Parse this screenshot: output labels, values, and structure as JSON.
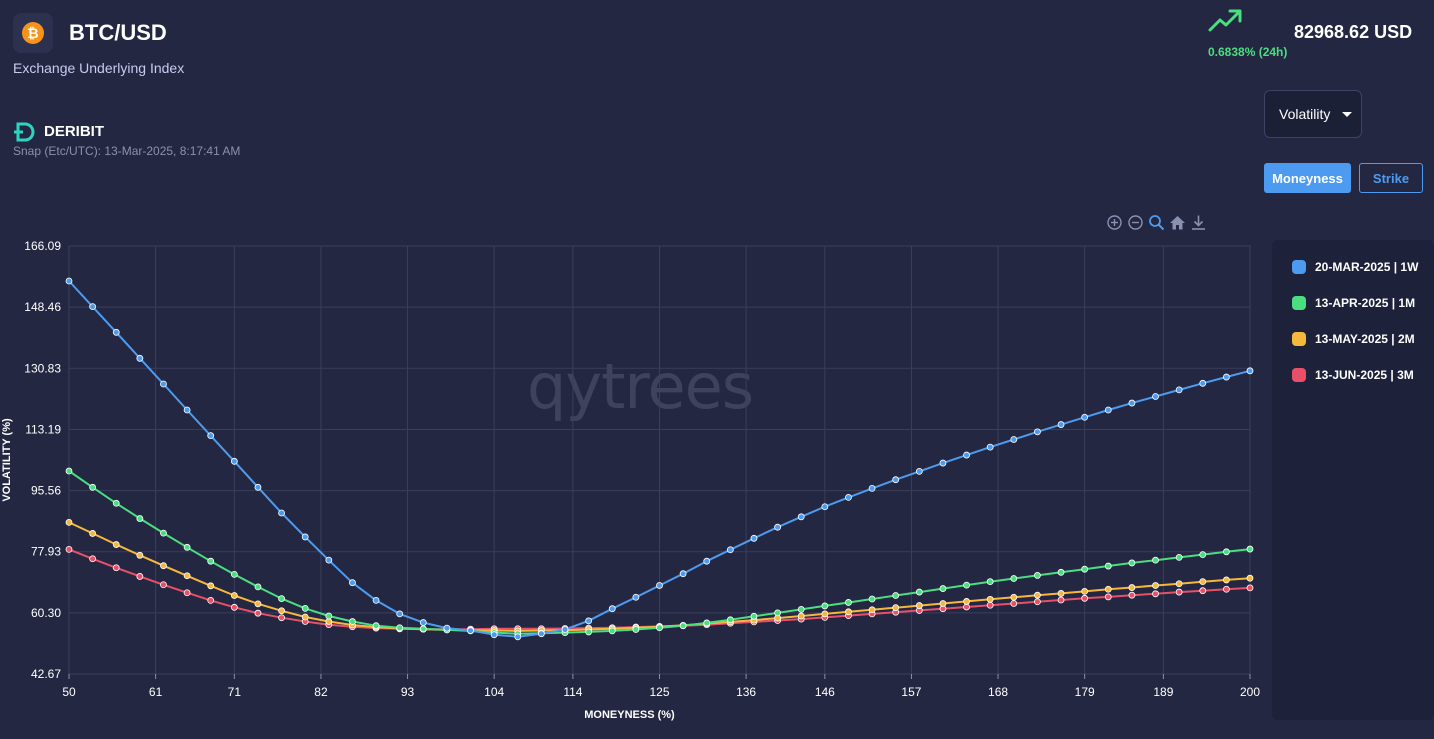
{
  "header": {
    "coin_icon": "bitcoin-icon",
    "coin_glyph": "₿",
    "pair": "BTC/USD",
    "subtitle": "Exchange Underlying Index",
    "change": "0.6838% (24h)",
    "price": "82968.62 USD",
    "trend_icon": "trend-up-icon",
    "change_color": "#4ade80"
  },
  "exchange": {
    "icon": "deribit-logo-icon",
    "name": "DERIBIT",
    "snap": "Snap (Etc/UTC): 13-Mar-2025, 8:17:41 AM"
  },
  "controls": {
    "select_value": "Volatility",
    "mode_buttons": [
      "Moneyness",
      "Strike"
    ],
    "active_mode": "Moneyness",
    "toolbar_icons": [
      "zoom-in-icon",
      "zoom-out-icon",
      "zoom-select-icon",
      "home-reset-icon",
      "download-icon"
    ]
  },
  "watermark": "qytrees",
  "chart_data": {
    "type": "line",
    "xlabel": "MONEYNESS (%)",
    "ylabel": "VOLATILITY (%)",
    "xlim": [
      50,
      200
    ],
    "ylim": [
      42.67,
      166.09
    ],
    "xticks": [
      "50",
      "61",
      "71",
      "82",
      "93",
      "104",
      "114",
      "125",
      "136",
      "146",
      "157",
      "168",
      "179",
      "189",
      "200"
    ],
    "yticks": [
      "42.67",
      "60.30",
      "77.93",
      "95.56",
      "113.19",
      "130.83",
      "148.46",
      "166.09"
    ],
    "grid": true,
    "legend_position": "right",
    "x": [
      50,
      53,
      56,
      59,
      62,
      65,
      68,
      71,
      74,
      77,
      80,
      83,
      86,
      89,
      92,
      95,
      98,
      101,
      104,
      107,
      110,
      113,
      116,
      119,
      122,
      125,
      128,
      131,
      134,
      137,
      140,
      143,
      146,
      149,
      152,
      155,
      158,
      161,
      164,
      167,
      170,
      173,
      176,
      179,
      182,
      185,
      188,
      191,
      194,
      197,
      200
    ],
    "series": [
      {
        "name": "20-MAR-2025 | 1W",
        "color": "#4d9bf0",
        "values": [
          156.0,
          148.6,
          141.2,
          133.7,
          126.3,
          118.8,
          111.4,
          104.0,
          96.5,
          89.1,
          82.2,
          75.5,
          69.0,
          63.9,
          60.0,
          57.5,
          55.9,
          55.2,
          54.0,
          53.4,
          54.3,
          55.5,
          58.0,
          61.5,
          64.8,
          68.2,
          71.6,
          75.2,
          78.5,
          81.8,
          85.0,
          88.0,
          90.9,
          93.6,
          96.2,
          98.7,
          101.1,
          103.5,
          105.8,
          108.1,
          110.3,
          112.5,
          114.6,
          116.7,
          118.8,
          120.8,
          122.7,
          124.6,
          126.5,
          128.3,
          130.1
        ]
      },
      {
        "name": "13-APR-2025 | 1M",
        "color": "#4ade80",
        "values": [
          101.2,
          96.5,
          91.9,
          87.5,
          83.3,
          79.2,
          75.2,
          71.4,
          67.8,
          64.4,
          61.6,
          59.4,
          57.8,
          56.6,
          56.0,
          55.7,
          55.4,
          55.1,
          54.6,
          54.3,
          54.4,
          54.6,
          54.8,
          55.1,
          55.5,
          56.0,
          56.6,
          57.4,
          58.3,
          59.3,
          60.3,
          61.3,
          62.3,
          63.3,
          64.3,
          65.3,
          66.3,
          67.3,
          68.3,
          69.3,
          70.2,
          71.1,
          72.0,
          72.9,
          73.8,
          74.7,
          75.5,
          76.3,
          77.1,
          77.9,
          78.7
        ]
      },
      {
        "name": "13-MAY-2025 | 2M",
        "color": "#f5b83d",
        "values": [
          86.4,
          83.2,
          80.0,
          76.9,
          73.9,
          71.0,
          68.1,
          65.3,
          62.9,
          60.9,
          59.1,
          57.8,
          56.8,
          56.2,
          55.8,
          55.6,
          55.4,
          55.3,
          55.2,
          55.1,
          55.2,
          55.3,
          55.5,
          55.7,
          56.0,
          56.3,
          56.7,
          57.2,
          57.7,
          58.2,
          58.8,
          59.4,
          60.0,
          60.6,
          61.2,
          61.8,
          62.4,
          63.0,
          63.6,
          64.2,
          64.8,
          65.4,
          65.9,
          66.5,
          67.1,
          67.6,
          68.2,
          68.7,
          69.3,
          69.8,
          70.3
        ]
      },
      {
        "name": "13-JUN-2025 | 3M",
        "color": "#e8506a",
        "values": [
          78.6,
          75.9,
          73.3,
          70.8,
          68.4,
          66.1,
          63.9,
          61.9,
          60.2,
          58.9,
          57.8,
          56.9,
          56.3,
          55.9,
          55.7,
          55.6,
          55.6,
          55.6,
          55.7,
          55.7,
          55.7,
          55.8,
          55.9,
          56.0,
          56.2,
          56.4,
          56.6,
          56.9,
          57.3,
          57.7,
          58.1,
          58.5,
          59.0,
          59.5,
          60.0,
          60.5,
          61.0,
          61.5,
          62.0,
          62.5,
          63.0,
          63.5,
          64.0,
          64.5,
          64.9,
          65.4,
          65.8,
          66.3,
          66.7,
          67.1,
          67.5
        ]
      }
    ]
  }
}
